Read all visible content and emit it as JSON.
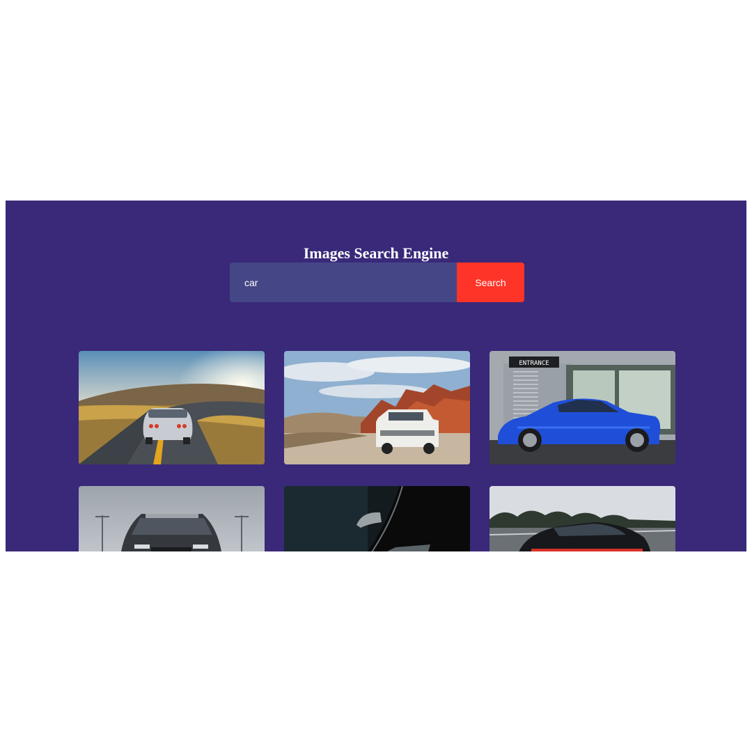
{
  "page": {
    "title": "Images Search Engine"
  },
  "search": {
    "value": "car",
    "button_label": "Search"
  },
  "colors": {
    "background": "#3a2879",
    "input_background": "#454686",
    "button_background": "#ff3428",
    "text": "#ffffff"
  },
  "results": [
    {
      "subject": "silver sports car on a winding desert road at sunset"
    },
    {
      "subject": "white SUV on a dirt road near red rock formations"
    },
    {
      "subject": "blue coupe parked in front of a building entrance",
      "sign_text": "ENTRANCE"
    },
    {
      "subject": "dark muscle car front view under a cloudy sky"
    },
    {
      "subject": "dark close-up of a car side mirror and fender"
    },
    {
      "subject": "black sedan rear view on a highway"
    }
  ]
}
